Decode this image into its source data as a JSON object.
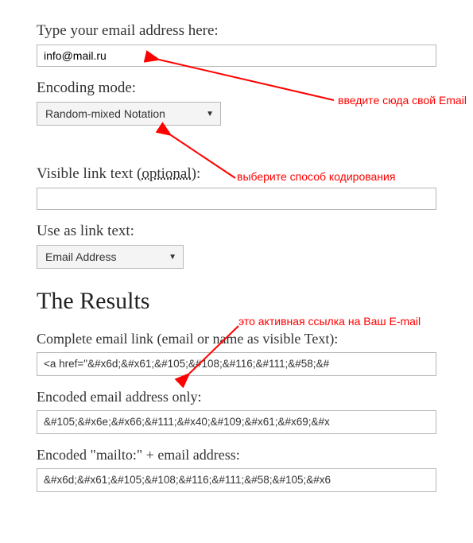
{
  "form": {
    "email_label": "Type your email address here:",
    "email_value": "info@mail.ru",
    "encoding_label": "Encoding mode:",
    "encoding_value": "Random-mixed Notation",
    "visible_label_prefix": "Visible link text (",
    "visible_label_opt": "optional",
    "visible_label_suffix": "):",
    "visible_value": "",
    "useas_label": "Use as link text:",
    "useas_value": "Email Address"
  },
  "results": {
    "heading": "The Results",
    "complete_label": "Complete email link (email or name as visible Text):",
    "complete_value": "<a href=\"&#x6d;&#x61;&#105;&#108;&#116;&#111;&#58;&#",
    "encoded_only_label": "Encoded email address only:",
    "encoded_only_value": "&#105;&#x6e;&#x66;&#111;&#x40;&#109;&#x61;&#x69;&#x",
    "mailto_label": "Encoded \"mailto:\" + email address:",
    "mailto_value": "&#x6d;&#x61;&#105;&#108;&#116;&#111;&#58;&#105;&#x6"
  },
  "annotations": {
    "a1": "введите сюда свой Email",
    "a2": "выберите способ кодирования",
    "a3": "это активная ссылка на Ваш E-mail"
  }
}
